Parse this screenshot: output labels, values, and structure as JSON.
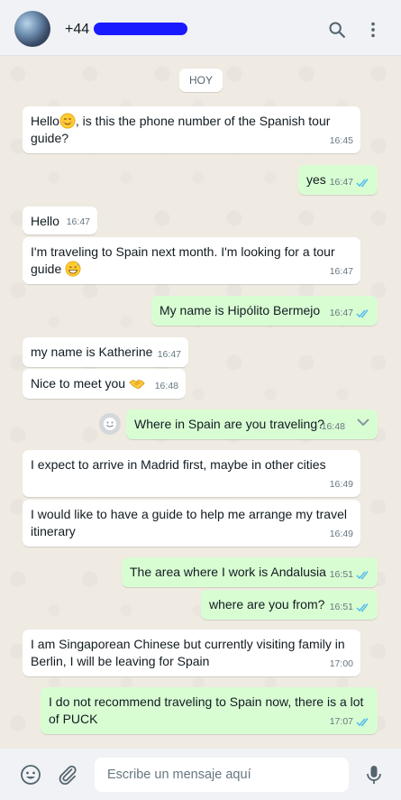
{
  "header": {
    "phone_prefix": "+44",
    "icons": [
      "search-icon",
      "menu-icon"
    ]
  },
  "chat": {
    "day_label": "HOY",
    "messages": [
      {
        "dir": "in",
        "text": "Hello",
        "emoji": "smiling-face",
        "text_after": ", is this the phone number of the Spanish tour guide?",
        "time": "16:45"
      },
      {
        "dir": "out",
        "text": "yes",
        "time": "16:47",
        "status": "read"
      },
      {
        "dir": "in",
        "text": "Hello",
        "time": "16:47"
      },
      {
        "dir": "in",
        "text": "I'm traveling to Spain next month. I'm looking for a tour guide",
        "emoji": "grinning-sweat-face",
        "time": "16:47"
      },
      {
        "dir": "out",
        "text": "My name is Hipólito Bermejo",
        "time": "16:47",
        "status": "read"
      },
      {
        "dir": "in",
        "text": "my name is Katherine",
        "time": "16:47"
      },
      {
        "dir": "in",
        "text": "Nice to meet you",
        "emoji": "handshake",
        "time": "16:48"
      },
      {
        "dir": "out",
        "text": "Where in Spain are you traveling?",
        "time": "16:48",
        "status": "read",
        "hovered": true
      },
      {
        "dir": "in",
        "text": "I expect to arrive in Madrid first, maybe in other cities",
        "time": "16:49"
      },
      {
        "dir": "in",
        "text": "I would like to have a guide to help me arrange my travel itinerary",
        "time": "16:49"
      },
      {
        "dir": "out",
        "text": "The area where I work is Andalusia",
        "time": "16:51",
        "status": "read"
      },
      {
        "dir": "out",
        "text": "where are you from?",
        "time": "16:51",
        "status": "read"
      },
      {
        "dir": "in",
        "text": "I am Singaporean Chinese but currently visiting family in Berlin, I will be leaving for Spain",
        "time": "17:00"
      },
      {
        "dir": "out",
        "text": "I do not recommend traveling to Spain now, there is a lot of PUCK",
        "time": "17:07",
        "status": "read"
      }
    ]
  },
  "composer": {
    "placeholder": "Escribe un mensaje aquí",
    "icons": [
      "emoji-icon",
      "attach-icon",
      "mic-icon"
    ]
  },
  "colors": {
    "incoming": "#ffffff",
    "outgoing": "#d9fdd3",
    "read_ticks": "#53bdeb",
    "background": "#efeae2"
  }
}
